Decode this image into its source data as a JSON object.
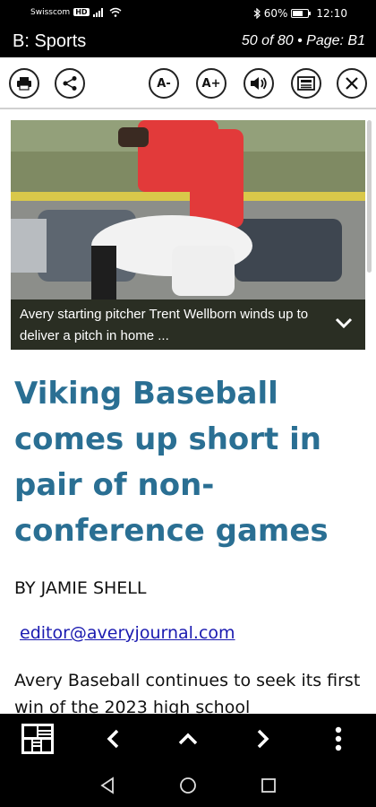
{
  "status_bar": {
    "carrier": "Swisscom",
    "network_badge": "HD",
    "battery": "60%",
    "time": "12:10"
  },
  "title_bar": {
    "section": "B: Sports",
    "page_info": "50 of 80 • Page: B1"
  },
  "toolbar": {
    "print_icon": "printer-icon",
    "share_icon": "share-icon",
    "font_smaller_label": "A-",
    "font_larger_label": "A+",
    "speaker_icon": "speaker-icon",
    "page_view_icon": "page-view-icon",
    "close_icon": "close-icon"
  },
  "article": {
    "photo_caption": "Avery starting pitcher Trent Wellborn winds up to deliver a pitch in home ...",
    "headline": "Viking Baseball comes up short in pair of non-conference games",
    "byline": "BY JAMIE SHELL",
    "email": "editor@averyjournal.com",
    "body_preview": "Avery Baseball continues to seek its first win of the 2023 high school"
  },
  "bottom_nav": {
    "grid_icon": "page-grid-icon",
    "prev_icon": "chevron-left-icon",
    "up_icon": "chevron-up-icon",
    "next_icon": "chevron-right-icon",
    "more_icon": "more-vertical-icon"
  },
  "system_nav": {
    "back_icon": "back-triangle-icon",
    "home_icon": "home-circle-icon",
    "recents_icon": "recents-square-icon"
  },
  "colors": {
    "headline": "#2a6f93",
    "link": "#1a1ab0",
    "bars": "#000000"
  }
}
